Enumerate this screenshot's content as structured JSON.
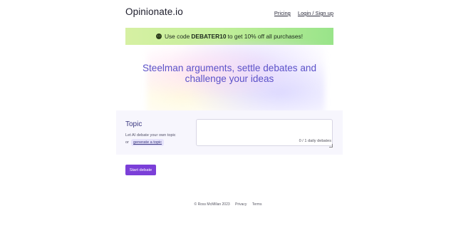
{
  "header": {
    "logo": "Opinionate.io",
    "nav": {
      "pricing": "Pricing",
      "login": "Login / Sign up"
    }
  },
  "promo": {
    "icon": "smiley-icon",
    "prefix": "Use code",
    "code": "DEBATER10",
    "suffix": "to get 10% off all purchases!"
  },
  "hero": {
    "title_line1": "Steelman arguments, settle debates and",
    "title_line2": "challenge your ideas"
  },
  "topic": {
    "title": "Topic",
    "desc_line1": "Let AI debate your own topic",
    "desc_or": "or",
    "generate_link": "generate a topic",
    "input_value": "",
    "counter": "0 / 1 daily debates"
  },
  "actions": {
    "start": "Start debate"
  },
  "footer": {
    "copyright": "© Ross McMillan 2023",
    "privacy": "Privacy",
    "terms": "Terms"
  },
  "colors": {
    "accent": "#7b3fd8",
    "hero_text": "#5b52c9",
    "promo_green": "#c3ef9a"
  }
}
